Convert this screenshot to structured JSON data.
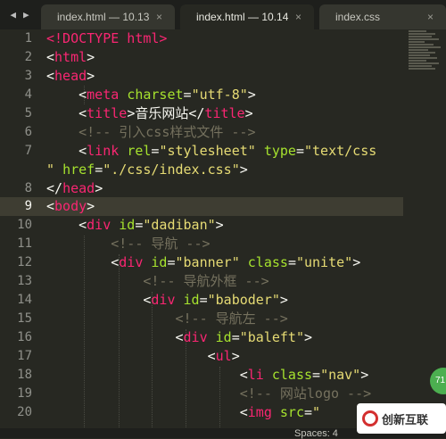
{
  "tabs": [
    {
      "label": "index.html — 10.13",
      "close": "×"
    },
    {
      "label": "index.html — 10.14",
      "close": "×"
    },
    {
      "label": "index.css",
      "close": "×"
    }
  ],
  "nav": {
    "back": "◀",
    "forward": "▶"
  },
  "line_numbers": [
    "1",
    "2",
    "3",
    "4",
    "5",
    "6",
    "7",
    "",
    "8",
    "9",
    "10",
    "11",
    "12",
    "13",
    "14",
    "15",
    "16",
    "17",
    "18",
    "19",
    "20"
  ],
  "current_line": "9",
  "code": {
    "l1": "<!DOCTYPE html>",
    "l2_tag": "html",
    "l3_tag": "head",
    "l4_tag": "meta",
    "l4_attr": "charset",
    "l4_val": "\"utf-8\"",
    "l5_tag": "title",
    "l5_text": "音乐网站",
    "l5_close": "title",
    "l6_comment": "<!-- 引入css样式文件 -->",
    "l7_tag": "link",
    "l7_attr1": "rel",
    "l7_val1": "\"stylesheet\"",
    "l7_attr2": "type",
    "l7_val2": "\"text/css",
    "l7b_val2": "\"",
    "l7b_attr3": "href",
    "l7b_val3": "\"./css/index.css\"",
    "l8_tag": "head",
    "l9_tag": "body",
    "l10_tag": "div",
    "l10_attr": "id",
    "l10_val": "\"dadiban\"",
    "l11_comment": "<!-- 导航 -->",
    "l12_tag": "div",
    "l12_attr1": "id",
    "l12_val1": "\"banner\"",
    "l12_attr2": "class",
    "l12_val2": "\"unite\"",
    "l13_comment": "<!-- 导航外框 -->",
    "l14_tag": "div",
    "l14_attr": "id",
    "l14_val": "\"baboder\"",
    "l15_comment": "<!-- 导航左 -->",
    "l16_tag": "div",
    "l16_attr": "id",
    "l16_val": "\"baleft\"",
    "l17_tag": "ul",
    "l18_tag": "li",
    "l18_attr": "class",
    "l18_val": "\"nav\"",
    "l19_comment": "<!-- 网站logo -->",
    "l20_tag": "img",
    "l20_attr": "src",
    "l20_val": "\""
  },
  "status": {
    "spaces": "Spaces: 4"
  },
  "badge": "71",
  "watermark": {
    "text": "创新互联"
  },
  "colors": {
    "bg": "#272822",
    "tag": "#f92672",
    "attr": "#a6e22e",
    "string": "#e6db74",
    "comment": "#75715e"
  }
}
